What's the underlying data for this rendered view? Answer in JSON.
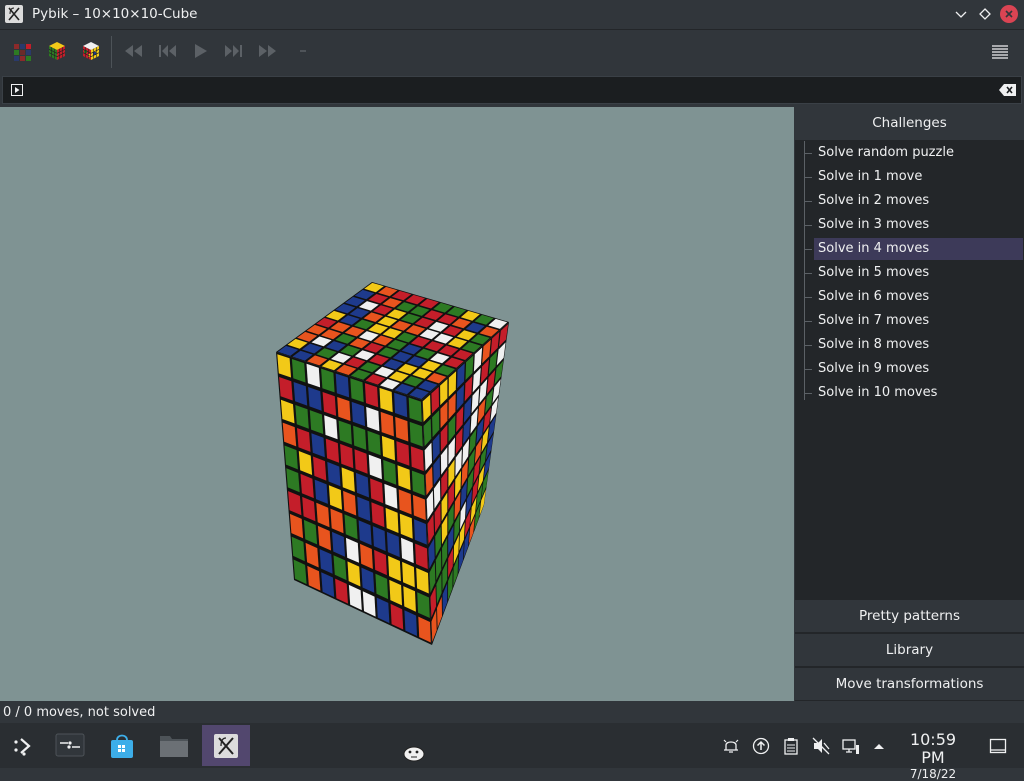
{
  "window": {
    "title": "Pybik – 10×10×10-Cube"
  },
  "toolbar": {
    "buttons": [
      "new-random-cube-icon",
      "new-solved-cube-icon",
      "new-scrambled-cube-icon",
      "rewind-icon",
      "previous-icon",
      "play-icon",
      "next-icon",
      "forward-icon",
      "remove-icon"
    ]
  },
  "sidebar": {
    "header": "Challenges",
    "items": [
      {
        "label": "Solve random puzzle"
      },
      {
        "label": "Solve in 1 move"
      },
      {
        "label": "Solve in 2 moves"
      },
      {
        "label": "Solve in 3 moves"
      },
      {
        "label": "Solve in 4 moves",
        "selected": true
      },
      {
        "label": "Solve in 5 moves"
      },
      {
        "label": "Solve in 6 moves"
      },
      {
        "label": "Solve in 7 moves"
      },
      {
        "label": "Solve in 8 moves"
      },
      {
        "label": "Solve in 9 moves"
      },
      {
        "label": "Solve in 10 moves"
      }
    ],
    "sections": [
      "Pretty patterns",
      "Library",
      "Move transformations"
    ]
  },
  "status": {
    "text": "0 / 0 moves, not solved"
  },
  "cube": {
    "size": 10,
    "colors": [
      "#f0f0f0",
      "#c41e2a",
      "#1e3a8c",
      "#f2c918",
      "#2d7a23",
      "#e8541e"
    ]
  },
  "taskbar": {
    "clock_time": "10:59 PM",
    "clock_date": "7/18/22"
  },
  "colors": {
    "accent": "#52476e",
    "selection": "#3d3a59",
    "close": "#da4453",
    "viewport": "#7f9393"
  }
}
